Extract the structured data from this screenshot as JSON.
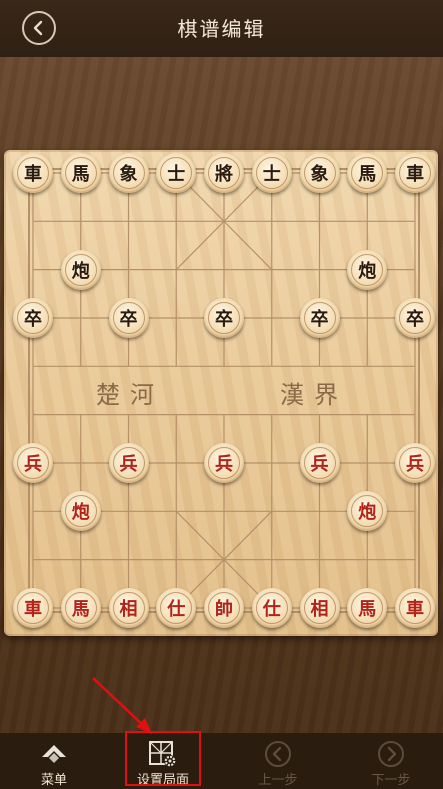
{
  "header": {
    "title": "棋谱编辑",
    "back_icon": "back-arrow-icon"
  },
  "board": {
    "river_left": "楚河",
    "river_right": "漢界",
    "pieces": [
      {
        "label": "車",
        "side": "black",
        "col": 0,
        "row": 0
      },
      {
        "label": "馬",
        "side": "black",
        "col": 1,
        "row": 0
      },
      {
        "label": "象",
        "side": "black",
        "col": 2,
        "row": 0
      },
      {
        "label": "士",
        "side": "black",
        "col": 3,
        "row": 0
      },
      {
        "label": "將",
        "side": "black",
        "col": 4,
        "row": 0
      },
      {
        "label": "士",
        "side": "black",
        "col": 5,
        "row": 0
      },
      {
        "label": "象",
        "side": "black",
        "col": 6,
        "row": 0
      },
      {
        "label": "馬",
        "side": "black",
        "col": 7,
        "row": 0
      },
      {
        "label": "車",
        "side": "black",
        "col": 8,
        "row": 0
      },
      {
        "label": "炮",
        "side": "black",
        "col": 1,
        "row": 2
      },
      {
        "label": "炮",
        "side": "black",
        "col": 7,
        "row": 2
      },
      {
        "label": "卒",
        "side": "black",
        "col": 0,
        "row": 3
      },
      {
        "label": "卒",
        "side": "black",
        "col": 2,
        "row": 3
      },
      {
        "label": "卒",
        "side": "black",
        "col": 4,
        "row": 3
      },
      {
        "label": "卒",
        "side": "black",
        "col": 6,
        "row": 3
      },
      {
        "label": "卒",
        "side": "black",
        "col": 8,
        "row": 3
      },
      {
        "label": "兵",
        "side": "red",
        "col": 0,
        "row": 6
      },
      {
        "label": "兵",
        "side": "red",
        "col": 2,
        "row": 6
      },
      {
        "label": "兵",
        "side": "red",
        "col": 4,
        "row": 6
      },
      {
        "label": "兵",
        "side": "red",
        "col": 6,
        "row": 6
      },
      {
        "label": "兵",
        "side": "red",
        "col": 8,
        "row": 6
      },
      {
        "label": "炮",
        "side": "red",
        "col": 1,
        "row": 7
      },
      {
        "label": "炮",
        "side": "red",
        "col": 7,
        "row": 7
      },
      {
        "label": "車",
        "side": "red",
        "col": 0,
        "row": 9
      },
      {
        "label": "馬",
        "side": "red",
        "col": 1,
        "row": 9
      },
      {
        "label": "相",
        "side": "red",
        "col": 2,
        "row": 9
      },
      {
        "label": "仕",
        "side": "red",
        "col": 3,
        "row": 9
      },
      {
        "label": "帥",
        "side": "red",
        "col": 4,
        "row": 9
      },
      {
        "label": "仕",
        "side": "red",
        "col": 5,
        "row": 9
      },
      {
        "label": "相",
        "side": "red",
        "col": 6,
        "row": 9
      },
      {
        "label": "馬",
        "side": "red",
        "col": 7,
        "row": 9
      },
      {
        "label": "車",
        "side": "red",
        "col": 8,
        "row": 9
      }
    ]
  },
  "footer": {
    "items": [
      {
        "label": "菜单",
        "icon": "menu-icon",
        "state": "active"
      },
      {
        "label": "设置局面",
        "icon": "setup-board-icon",
        "state": "active"
      },
      {
        "label": "上一步",
        "icon": "previous-step-icon",
        "state": "disabled"
      },
      {
        "label": "下一步",
        "icon": "next-step-icon",
        "state": "disabled"
      }
    ]
  },
  "colors": {
    "red_piece_text": "#b0241a",
    "black_piece_text": "#2a1a10",
    "highlight": "#e01010"
  }
}
